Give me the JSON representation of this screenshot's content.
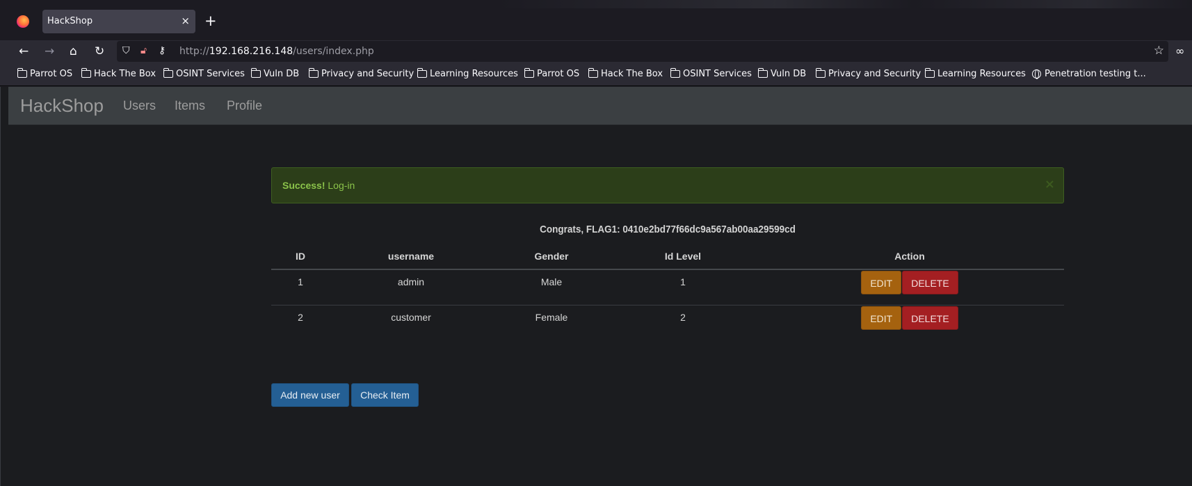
{
  "browser": {
    "tab_title": "HackShop",
    "tab_close": "×",
    "new_tab": "+",
    "url_prefix": "http://",
    "url_host": "192.168.216.148",
    "url_path": "/users/index.php"
  },
  "bookmarks": [
    {
      "label": "Parrot OS",
      "icon": "folder-icon"
    },
    {
      "label": "Hack The Box",
      "icon": "folder-icon"
    },
    {
      "label": "OSINT Services",
      "icon": "folder-icon"
    },
    {
      "label": "Vuln DB",
      "icon": "folder-icon"
    },
    {
      "label": "Privacy and Security",
      "icon": "folder-icon"
    },
    {
      "label": "Learning Resources",
      "icon": "folder-icon"
    },
    {
      "label": "Parrot OS",
      "icon": "folder-icon"
    },
    {
      "label": "Hack The Box",
      "icon": "folder-icon"
    },
    {
      "label": "OSINT Services",
      "icon": "folder-icon"
    },
    {
      "label": "Vuln DB",
      "icon": "folder-icon"
    },
    {
      "label": "Privacy and Security",
      "icon": "folder-icon"
    },
    {
      "label": "Learning Resources",
      "icon": "folder-icon"
    },
    {
      "label": "Penetration testing t...",
      "icon": "globe-icon"
    }
  ],
  "site": {
    "brand": "HackShop",
    "nav": [
      "Users",
      "Items",
      "Profile"
    ]
  },
  "alert": {
    "strong": "Success!",
    "message": "Log-in",
    "close": "×"
  },
  "flag_text": "Congrats, FLAG1: 0410e2bd77f66dc9a567ab00aa29599cd",
  "table": {
    "headers": [
      "ID",
      "username",
      "Gender",
      "Id Level",
      "Action"
    ],
    "rows": [
      {
        "id": "1",
        "username": "admin",
        "gender": "Male",
        "level": "1"
      },
      {
        "id": "2",
        "username": "customer",
        "gender": "Female",
        "level": "2"
      }
    ],
    "edit_label": "EDIT",
    "delete_label": "DELETE"
  },
  "buttons": {
    "add_user": "Add new user",
    "check_item": "Check Item"
  },
  "colors": {
    "alert_bg": "#2c3e19",
    "edit_button": "#a5620f",
    "delete_button": "#a41f22",
    "primary_button": "#245f94"
  }
}
